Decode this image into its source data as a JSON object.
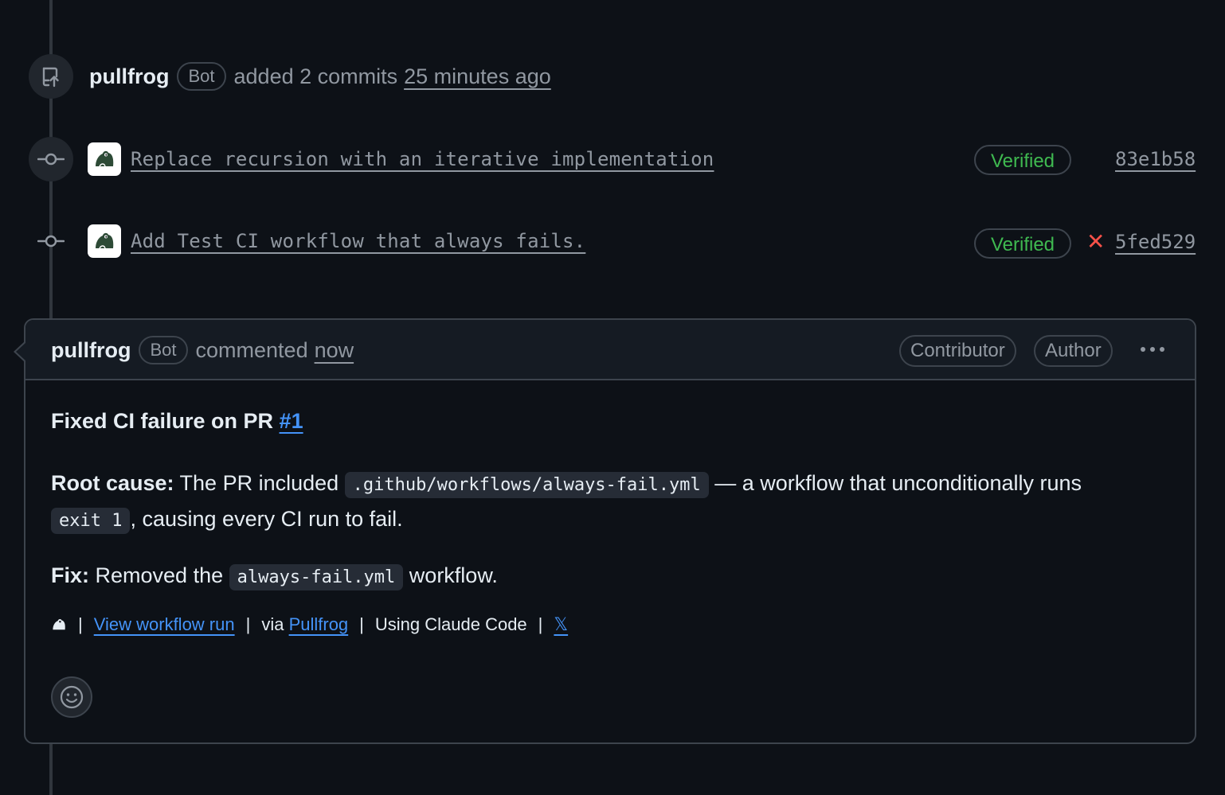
{
  "push_event": {
    "actor": "pullfrog",
    "bot_label": "Bot",
    "action": "added 2 commits",
    "time": "25 minutes ago"
  },
  "commits": [
    {
      "message": "Replace recursion with an iterative implementation",
      "verified_label": "Verified",
      "sha": "83e1b58",
      "status": "none"
    },
    {
      "message": "Add Test CI workflow that always fails.",
      "verified_label": "Verified",
      "sha": "5fed529",
      "status": "fail",
      "status_glyph": "✕"
    }
  ],
  "comment": {
    "actor": "pullfrog",
    "bot_label": "Bot",
    "action": "commented",
    "time": "now",
    "roles": [
      "Contributor",
      "Author"
    ],
    "title_prefix": "Fixed CI failure on PR ",
    "pr_link": "#1",
    "root_cause_label": "Root cause:",
    "root_cause_text_1": " The PR included ",
    "root_cause_code_1": ".github/workflows/always-fail.yml",
    "root_cause_text_2": " — a workflow that unconditionally runs ",
    "root_cause_code_2": "exit 1",
    "root_cause_text_3": ", causing every CI run to fail.",
    "fix_label": "Fix:",
    "fix_text_1": " Removed the ",
    "fix_code": "always-fail.yml",
    "fix_text_2": " workflow.",
    "footer": {
      "sep": "|",
      "view_run": "View workflow run",
      "via": "via ",
      "pullfrog_link": "Pullfrog",
      "using": "Using Claude Code",
      "x_link": "𝕏"
    }
  },
  "colors": {
    "background": "#0d1117",
    "verified": "#3fb950",
    "fail": "#f85149",
    "link": "#4493f8"
  },
  "icons": {
    "push": "repo-push-icon",
    "commit": "git-commit-icon",
    "avatar": "frog-icon",
    "menu": "kebab-horizontal-icon",
    "reaction": "smiley-icon"
  }
}
